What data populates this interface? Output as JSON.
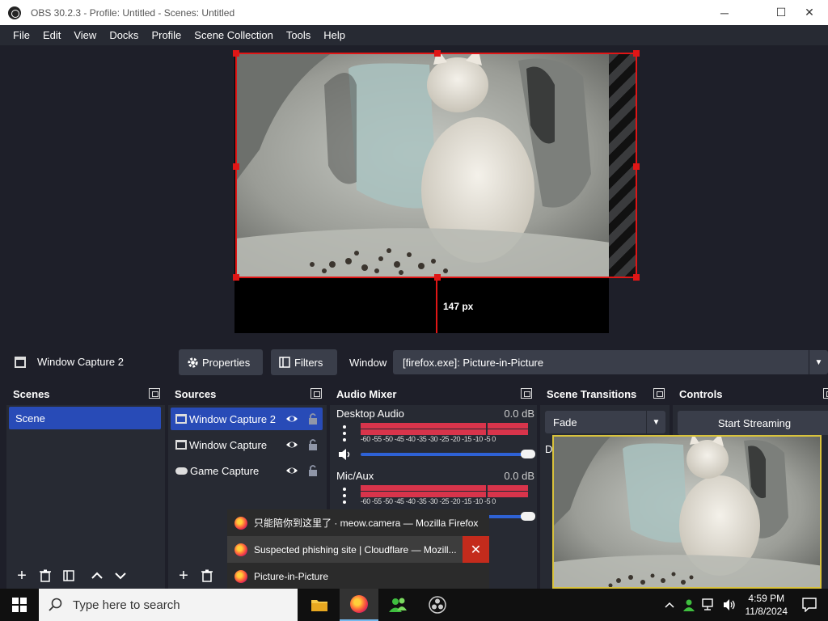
{
  "window": {
    "title": "OBS 30.2.3 - Profile: Untitled - Scenes: Untitled",
    "minimize": "─",
    "maximize": "☐",
    "close": "✕"
  },
  "menu": [
    "File",
    "Edit",
    "View",
    "Docks",
    "Profile",
    "Scene Collection",
    "Tools",
    "Help"
  ],
  "preview": {
    "distance_label": "147 px"
  },
  "context_bar": {
    "source_name": "Window Capture 2",
    "properties_label": "Properties",
    "filters_label": "Filters",
    "window_label": "Window",
    "window_value": "[firefox.exe]: Picture-in-Picture"
  },
  "scenes": {
    "title": "Scenes",
    "items": [
      "Scene"
    ]
  },
  "sources": {
    "title": "Sources",
    "items": [
      {
        "label": "Window Capture 2",
        "icon": "window-icon",
        "selected": true
      },
      {
        "label": "Window Capture",
        "icon": "window-icon",
        "selected": false
      },
      {
        "label": "Game Capture",
        "icon": "gamepad-icon",
        "selected": false
      }
    ]
  },
  "mixer": {
    "title": "Audio Mixer",
    "channels": [
      {
        "name": "Desktop Audio",
        "db": "0.0 dB"
      },
      {
        "name": "Mic/Aux",
        "db": "0.0 dB"
      }
    ],
    "ticks": "-60 -55 -50 -45 -40 -35 -30 -25 -20 -15 -10 -5  0"
  },
  "transitions": {
    "title": "Scene Transitions",
    "selected": "Fade",
    "duration_label": "Du"
  },
  "controls": {
    "title": "Controls",
    "start_streaming": "Start Streaming"
  },
  "taskbar_popup": {
    "items": [
      {
        "label": "只能陪你到这里了 · meow.camera — Mozilla Firefox"
      },
      {
        "label": "Suspected phishing site | Cloudflare — Mozill..."
      },
      {
        "label": "Picture-in-Picture"
      }
    ],
    "close": "✕"
  },
  "taskbar": {
    "search_placeholder": "Type here to search",
    "time": "4:59 PM",
    "date": "11/8/2024"
  },
  "colors": {
    "accent": "#284bb7",
    "selection": "#e01616",
    "pip_border": "#d8c23c"
  }
}
